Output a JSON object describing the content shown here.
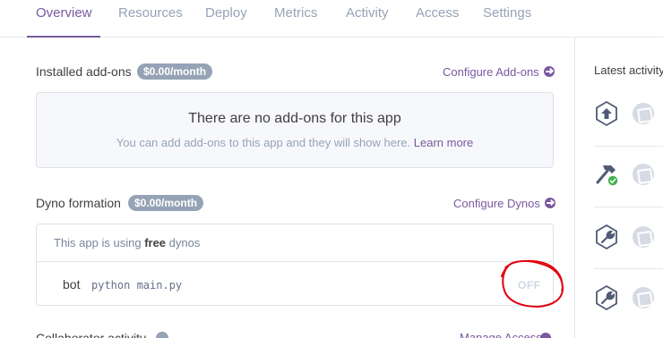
{
  "tabs": [
    {
      "label": "Overview",
      "active": true
    },
    {
      "label": "Resources",
      "active": false
    },
    {
      "label": "Deploy",
      "active": false
    },
    {
      "label": "Metrics",
      "active": false
    },
    {
      "label": "Activity",
      "active": false
    },
    {
      "label": "Access",
      "active": false
    },
    {
      "label": "Settings",
      "active": false
    }
  ],
  "addons": {
    "title": "Installed add-ons",
    "price": "$0.00/month",
    "configure_label": "Configure Add-ons",
    "empty_title": "There are no add-ons for this app",
    "empty_text": "You can add add-ons to this app and they will show here.",
    "learn_more": "Learn more"
  },
  "dynos": {
    "title": "Dyno formation",
    "price": "$0.00/month",
    "configure_label": "Configure Dynos",
    "note_prefix": "This app is using",
    "note_type": "free",
    "note_suffix": "dynos",
    "process_name": "bot",
    "process_command": "python main.py",
    "state": "OFF"
  },
  "collaborator": {
    "title": "Collaborator activity",
    "link": "Manage Access"
  },
  "activity": {
    "title": "Latest activity",
    "items": [
      {
        "icon": "deploy-upload-icon"
      },
      {
        "icon": "build-succeeded-icon"
      },
      {
        "icon": "config-wrench-icon"
      },
      {
        "icon": "config-wrench-icon"
      }
    ]
  },
  "colors": {
    "accent": "#79589f",
    "badge": "#96a3b6",
    "success": "#3fb34f",
    "annotation": "#e3000f"
  }
}
